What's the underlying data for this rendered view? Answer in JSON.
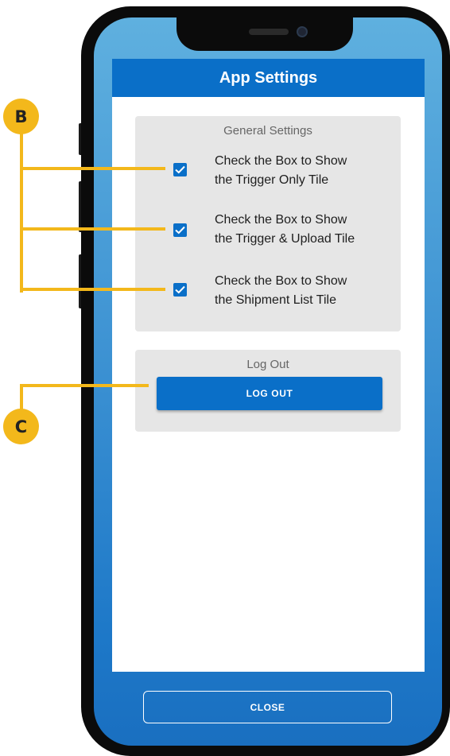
{
  "app": {
    "title": "App Settings",
    "general_settings": {
      "heading": "General Settings",
      "options": [
        {
          "line1": "Check the Box to Show",
          "line2": "the Trigger Only Tile",
          "checked": true
        },
        {
          "line1": "Check the Box to Show",
          "line2": "the Trigger & Upload Tile",
          "checked": true
        },
        {
          "line1": "Check the Box to Show",
          "line2": "the Shipment List Tile",
          "checked": true
        }
      ]
    },
    "logout_section": {
      "heading": "Log Out",
      "button_label": "LOG OUT"
    },
    "close_button_label": "CLOSE"
  },
  "annotations": {
    "b": "B",
    "c": "C"
  },
  "colors": {
    "accent": "#0a6fc8",
    "callout": "#f3b81b",
    "card_bg": "#e6e6e6"
  },
  "icons": [
    "checkmark-icon",
    "speaker-grille",
    "front-camera"
  ]
}
